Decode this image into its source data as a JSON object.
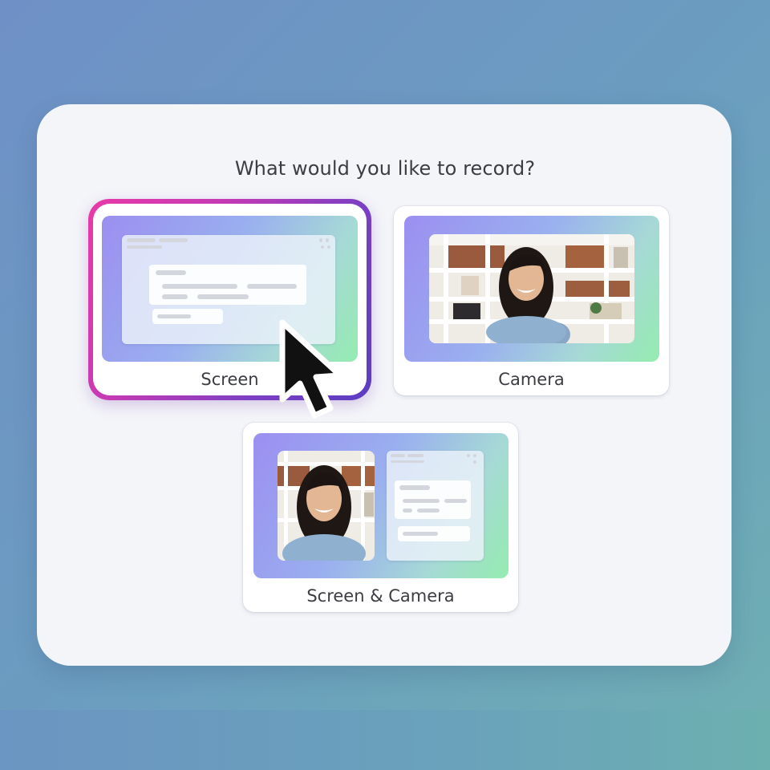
{
  "dialog": {
    "title": "What would you like to record?"
  },
  "options": [
    {
      "label": "Screen",
      "selected": true,
      "icon": "screen-preview"
    },
    {
      "label": "Camera",
      "selected": false,
      "icon": "camera-preview"
    },
    {
      "label": "Screen & Camera",
      "selected": false,
      "icon": "screen-camera-preview"
    }
  ],
  "colors": {
    "selection_start": "#e93aa8",
    "selection_end": "#5b3dc2",
    "thumb_start": "#9b8ff0",
    "thumb_end": "#95ecb0",
    "text": "#3b3d42"
  },
  "cursor": {
    "icon": "mouse-pointer-icon"
  }
}
